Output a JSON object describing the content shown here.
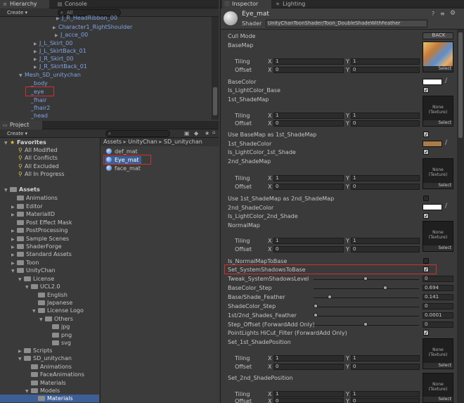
{
  "hierarchy": {
    "tab": "Hierarchy",
    "console_tab": "Console",
    "create": "Create ▾",
    "search_text": "All",
    "items": [
      {
        "label": "J_R_HeadRibbon_00"
      },
      {
        "label": "Character1_RightShoulder"
      },
      {
        "label": "J_acce_00"
      },
      {
        "label": "J_L_Skirt_00"
      },
      {
        "label": "J_L_SkirtBack_01"
      },
      {
        "label": "J_R_Skirt_00"
      },
      {
        "label": "J_R_SkirtBack_01"
      },
      {
        "label": "Mesh_SD_unitychan"
      },
      {
        "label": "_body"
      },
      {
        "label": "_eye"
      },
      {
        "label": "_fhair"
      },
      {
        "label": "_fhair2"
      },
      {
        "label": "_head"
      }
    ]
  },
  "project": {
    "tab": "Project",
    "create": "Create ▾",
    "favorites": {
      "label": "Favorites",
      "items": [
        "All Modified",
        "All Conflicts",
        "All Excluded",
        "All In Progress"
      ]
    },
    "tree": [
      {
        "label": "Assets"
      },
      {
        "label": "Animations"
      },
      {
        "label": "Editor"
      },
      {
        "label": "MaterialID"
      },
      {
        "label": "Post Effect Mask"
      },
      {
        "label": "PostProcessing"
      },
      {
        "label": "Sample Scenes"
      },
      {
        "label": "ShaderForge"
      },
      {
        "label": "Standard Assets"
      },
      {
        "label": "Toon"
      },
      {
        "label": "UnityChan"
      },
      {
        "label": "License"
      },
      {
        "label": "UCL2.0"
      },
      {
        "label": "English"
      },
      {
        "label": "Japanese"
      },
      {
        "label": "License Logo"
      },
      {
        "label": "Others"
      },
      {
        "label": "jpg"
      },
      {
        "label": "png"
      },
      {
        "label": "svg"
      },
      {
        "label": "Scripts"
      },
      {
        "label": "SD_unitychan"
      },
      {
        "label": "Animations"
      },
      {
        "label": "FaceAnimations"
      },
      {
        "label": "Materials"
      },
      {
        "label": "Models"
      },
      {
        "label": "Materials"
      }
    ],
    "breadcrumb": [
      "Assets",
      "UnityChan",
      "SD_unitychan"
    ],
    "files": [
      "def_mat",
      "Eye_mat",
      "face_mat"
    ]
  },
  "inspector": {
    "tab": "Inspector",
    "lighting_tab": "Lighting",
    "material_name": "Eye_mat",
    "shader_label": "Shader",
    "shader_value": "UnityChanToonShader/Toon_DoubleShadeWithFeather",
    "cull_mode_label": "Cull Mode",
    "cull_mode_value": "BACK",
    "select": "Select",
    "none_texture": "None\n(Texture)",
    "tiling": "Tiling",
    "offset": "Offset",
    "x": "X",
    "y": "Y",
    "labels": {
      "basemap": "BaseMap",
      "basecolor": "BaseColor",
      "is_lightcolor_base": "Is_LightColor_Base",
      "shademap1": "1st_ShadeMap",
      "use_basemap_as_1st": "Use BaseMap as 1st_ShadeMap",
      "shadecolor1": "1st_ShadeColor",
      "is_lightcolor_1st": "Is_LightColor_1st_Shade",
      "shademap2": "2nd_ShadeMap",
      "use_1st_as_2nd": "Use 1st_ShadeMap as 2nd_ShadeMap",
      "shadecolor2": "2nd_ShadeColor",
      "is_lightcolor_2nd": "Is_LightColor_2nd_Shade",
      "normalmap": "NormalMap",
      "is_normalmap_to_base": "Is_NormalMapToBase",
      "set_system_shadows": "Set_SystemShadowsToBase",
      "tweak_system_shadows": "Tweak_SystemShadowsLevel",
      "basecolor_step": "BaseColor_Step",
      "base_shade_feather": "Base/Shade_Feather",
      "shadecolor_step": "ShadeColor_Step",
      "shades_feather": "1st/2nd_Shades_Feather",
      "step_offset": "Step_Offset (ForwardAdd Only)",
      "pointlights_hicut": "PointLights HiCut_Filter (ForwardAdd Only)",
      "set_1st_shadeposition": "Set_1st_ShadePosition",
      "set_2nd_shadeposition": "Set_2nd_ShadePosition"
    },
    "values": {
      "one": "1",
      "zero": "0",
      "tweak": "0",
      "basecolor_step": "0.694",
      "base_shade_feather": "0.141",
      "shadecolor_step": "0",
      "shades_feather": "0.0001",
      "step_offset": "0"
    },
    "sliders": {
      "tweak": 0.5,
      "basecolor_step": 0.694,
      "base_shade_feather": 0.141,
      "shadecolor_step": 0.0,
      "shades_feather": 0.0001,
      "step_offset": 0.5
    },
    "colors": {
      "basecolor": "#ffffff",
      "shadecolor1": "#a97d4a",
      "shadecolor2": "#ffffff"
    }
  },
  "colors": {
    "panel_bg": "#383838",
    "selection": "#3e5f96",
    "highlight_box": "#d03030",
    "link_blue": "#7fa4e6"
  }
}
